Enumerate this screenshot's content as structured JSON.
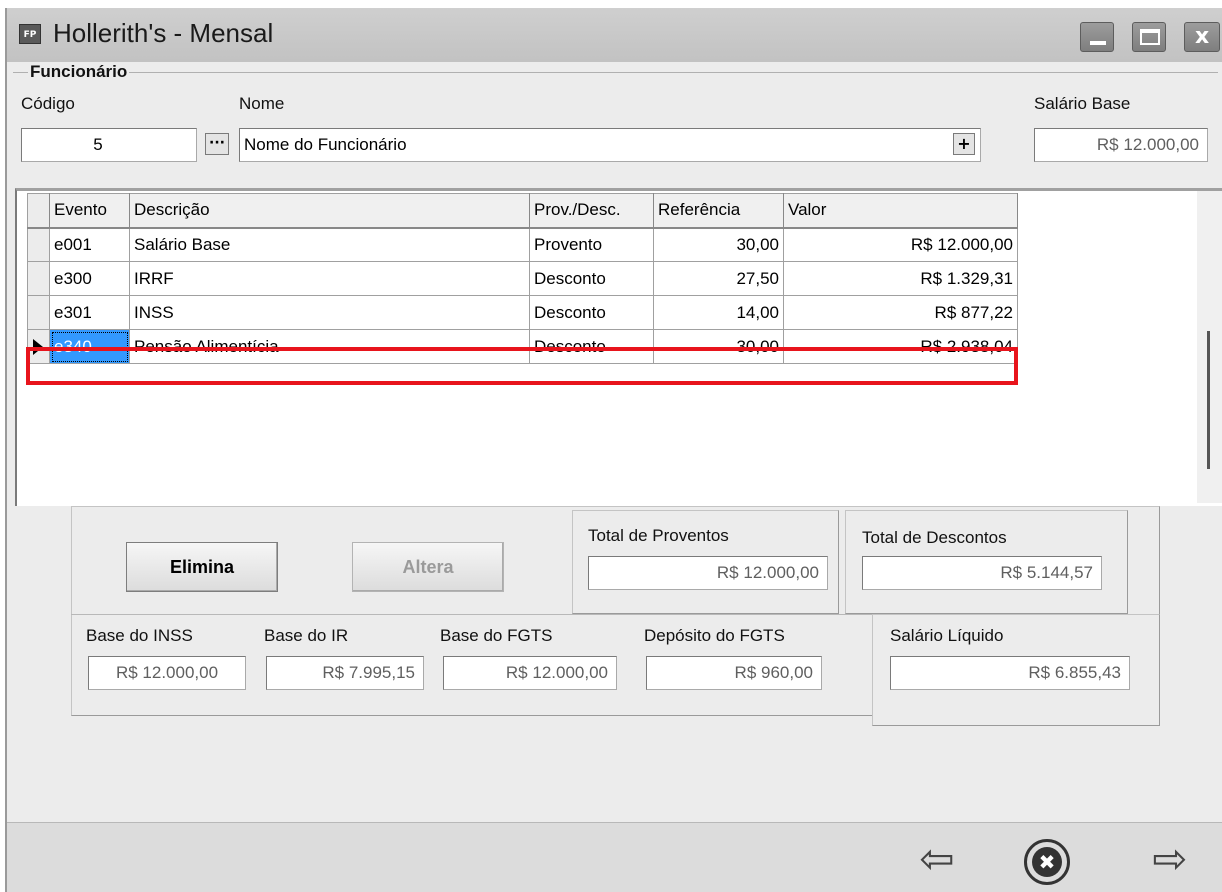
{
  "window": {
    "title": "Hollerith's - Mensal",
    "icon_text": "FP"
  },
  "funcionario": {
    "group_label": "Funcionário",
    "codigo_label": "Código",
    "codigo_value": "5",
    "lookup_button": "···",
    "nome_label": "Nome",
    "nome_value": "Nome do Funcionário",
    "add_button": "+",
    "salario_label": "Salário Base",
    "salario_value": "R$ 12.000,00"
  },
  "grid": {
    "columns": [
      "Evento",
      "Descrição",
      "Prov./Desc.",
      "Referência",
      "Valor"
    ],
    "rows": [
      {
        "evento": "e001",
        "descricao": "Salário Base",
        "tipo": "Provento",
        "referencia": "30,00",
        "valor": "R$ 12.000,00"
      },
      {
        "evento": "e300",
        "descricao": "IRRF",
        "tipo": "Desconto",
        "referencia": "27,50",
        "valor": "R$ 1.329,31"
      },
      {
        "evento": "e301",
        "descricao": "INSS",
        "tipo": "Desconto",
        "referencia": "14,00",
        "valor": "R$ 877,22"
      },
      {
        "evento": "e340",
        "descricao": "Pensão Alimentícia",
        "tipo": "Desconto",
        "referencia": "30,00",
        "valor": "R$ 2.938,04"
      }
    ],
    "highlight_color": "#e8141c",
    "selection_color": "#3399ff"
  },
  "actions": {
    "elimina": "Elimina",
    "altera": "Altera"
  },
  "totais": {
    "proventos_label": "Total de Proventos",
    "proventos_value": "R$ 12.000,00",
    "descontos_label": "Total de Descontos",
    "descontos_value": "R$ 5.144,57"
  },
  "bases": {
    "inss_label": "Base do INSS",
    "inss_value": "R$ 12.000,00",
    "ir_label": "Base do IR",
    "ir_value": "R$ 7.995,15",
    "fgts_label": "Base do FGTS",
    "fgts_value": "R$ 12.000,00",
    "deposito_label": "Depósito do FGTS",
    "deposito_value": "R$ 960,00",
    "liquido_label": "Salário Líquido",
    "liquido_value": "R$ 6.855,43"
  },
  "footer": {
    "prev_icon": "⇦",
    "cancel_icon": "✖",
    "next_icon": "⇨"
  }
}
